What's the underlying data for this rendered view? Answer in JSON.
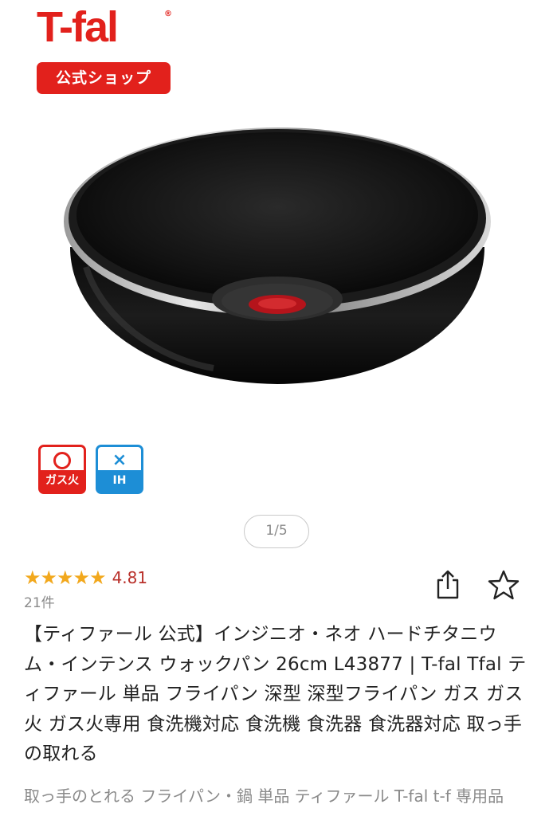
{
  "brand": {
    "logo_text": "T-fal",
    "tm": "®",
    "shop_badge": "公式ショップ",
    "color": "#e2211c"
  },
  "product_image": {
    "icon": "wok-pan-image"
  },
  "heat_badges": [
    {
      "mark": "○",
      "label": "ガス火",
      "color": "#e2211c"
    },
    {
      "mark": "×",
      "label": "IH",
      "color": "#1d8ed6"
    }
  ],
  "pager": {
    "text": "1/5"
  },
  "rating": {
    "stars": "★★★★★",
    "value": "4.81",
    "review_count": "21件",
    "star_color": "#f2a81d"
  },
  "actions": {
    "share_icon": "share-icon",
    "favorite_icon": "star-outline-icon"
  },
  "product": {
    "title": "【ティファール 公式】インジニオ・ネオ ハードチタニウム・インテンス ウォックパン 26cm L43877 | T-fal Tfal ティファール 単品 フライパン 深型 深型フライパン ガス ガス火 ガス火専用 食洗機対応 食洗機 食洗器 食洗器対応 取っ手の取れる",
    "subtitle": "取っ手のとれる フライパン・鍋 単品 ティファール T-fal t-f 専用品"
  }
}
